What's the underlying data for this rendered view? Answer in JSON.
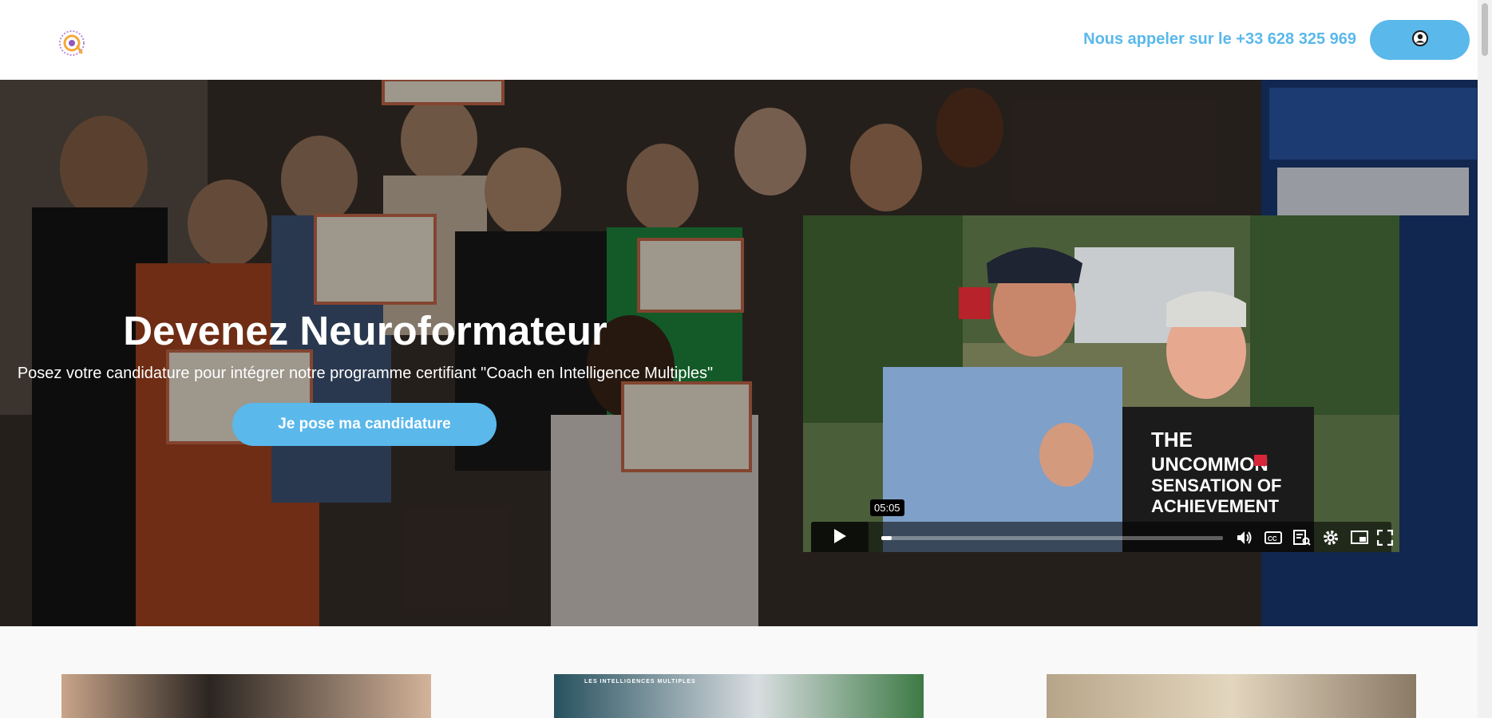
{
  "header": {
    "phone_text": "Nous appeler sur le +33 628 325 969",
    "brand_color": "#5ab8eb"
  },
  "hero": {
    "title": "Devenez Neuroformateur",
    "subtitle": "Posez votre candidature pour intégrer notre programme certifiant \"Coach en Intelligence Multiples\"",
    "cta_label": "Je pose ma candidature"
  },
  "video": {
    "time_label": "05:05",
    "progress_fraction": 0.03,
    "icons": [
      "play-icon",
      "volume-icon",
      "captions-icon",
      "transcript-icon",
      "settings-icon",
      "pip-icon",
      "fullscreen-icon"
    ]
  },
  "cards": [
    {
      "image": "people-photo"
    },
    {
      "image": "intelligences-board-photo",
      "caption": "LES INTELLIGENCES MULTIPLES"
    },
    {
      "image": "certificates-photo"
    }
  ]
}
